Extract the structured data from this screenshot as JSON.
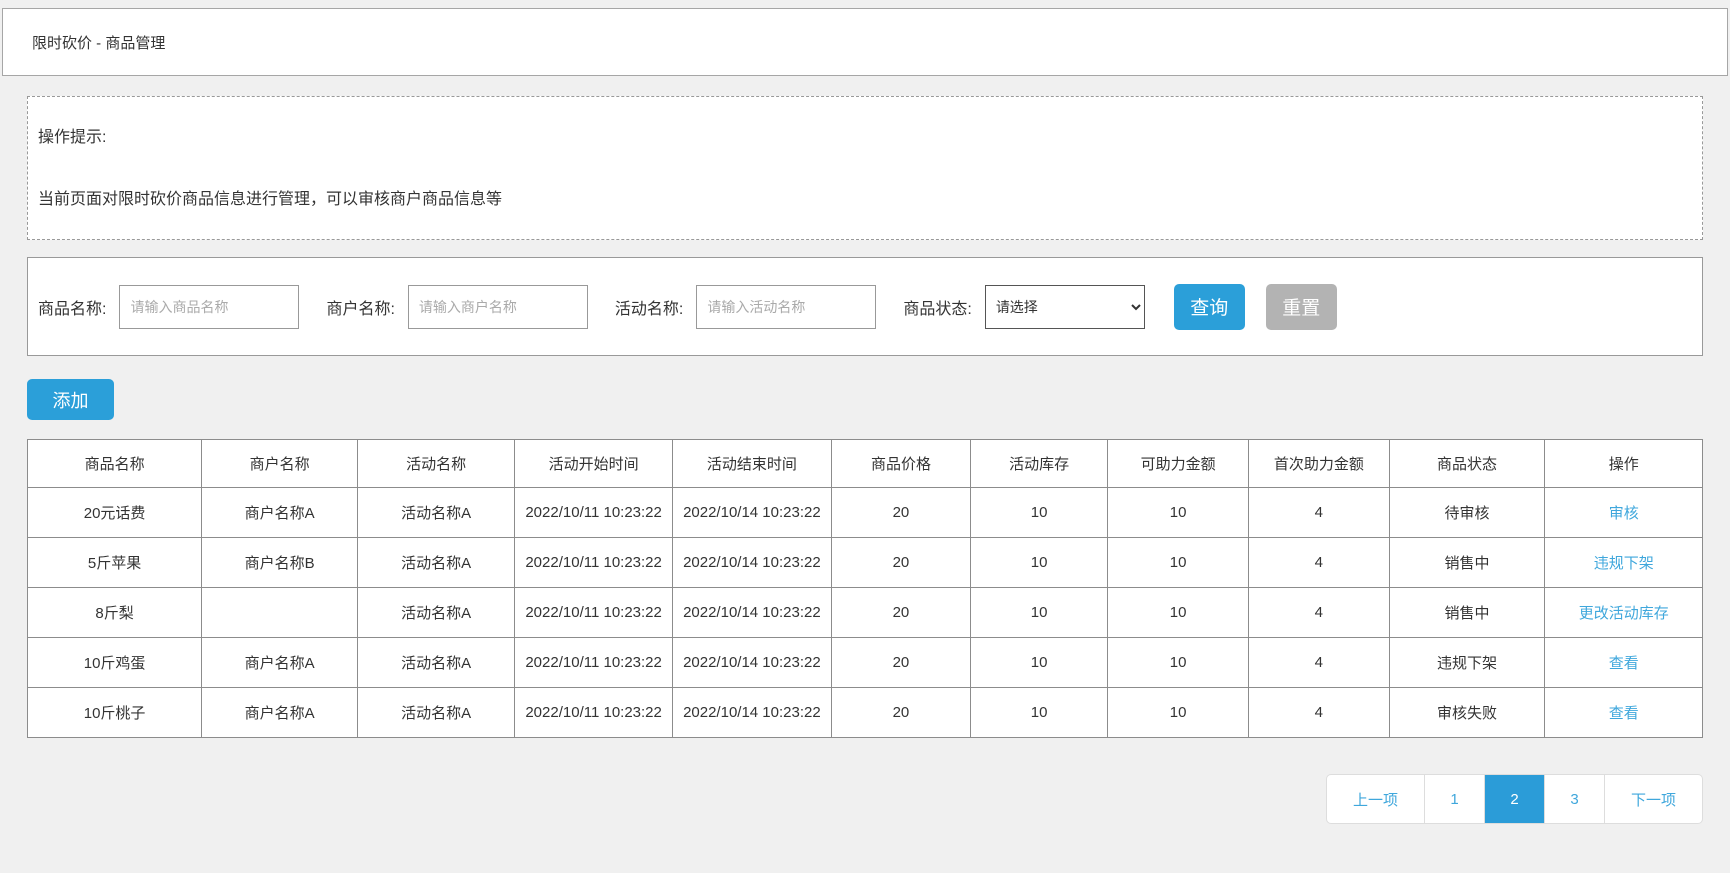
{
  "page": {
    "title": "限时砍价 - 商品管理"
  },
  "tips": {
    "title": "操作提示:",
    "body": "当前页面对限时砍价商品信息进行管理，可以审核商户商品信息等"
  },
  "filters": {
    "fields": [
      {
        "label": "商品名称:",
        "placeholder": "请输入商品名称"
      },
      {
        "label": "商户名称:",
        "placeholder": "请输入商户名称"
      },
      {
        "label": "活动名称:",
        "placeholder": "请输入活动名称"
      }
    ],
    "status": {
      "label": "商品状态:",
      "selected": "请选择"
    },
    "search_label": "查询",
    "reset_label": "重置"
  },
  "toolbar": {
    "add_label": "添加"
  },
  "table": {
    "headers": [
      "商品名称",
      "商户名称",
      "活动名称",
      "活动开始时间",
      "活动结束时间",
      "商品价格",
      "活动库存",
      "可助力金额",
      "首次助力金额",
      "商品状态",
      "操作"
    ],
    "rows": [
      {
        "cells": [
          "20元话费",
          "商户名称A",
          "活动名称A",
          "2022/10/11 10:23:22",
          "2022/10/14 10:23:22",
          "20",
          "10",
          "10",
          "4",
          "待审核"
        ],
        "action": "审核"
      },
      {
        "cells": [
          "5斤苹果",
          "商户名称B",
          "活动名称A",
          "2022/10/11 10:23:22",
          "2022/10/14 10:23:22",
          "20",
          "10",
          "10",
          "4",
          "销售中"
        ],
        "action": "违规下架"
      },
      {
        "cells": [
          "8斤梨",
          "",
          "活动名称A",
          "2022/10/11 10:23:22",
          "2022/10/14 10:23:22",
          "20",
          "10",
          "10",
          "4",
          "销售中"
        ],
        "action": "更改活动库存"
      },
      {
        "cells": [
          "10斤鸡蛋",
          "商户名称A",
          "活动名称A",
          "2022/10/11 10:23:22",
          "2022/10/14 10:23:22",
          "20",
          "10",
          "10",
          "4",
          "违规下架"
        ],
        "action": "查看"
      },
      {
        "cells": [
          "10斤桃子",
          "商户名称A",
          "活动名称A",
          "2022/10/11 10:23:22",
          "2022/10/14 10:23:22",
          "20",
          "10",
          "10",
          "4",
          "审核失败"
        ],
        "action": "查看"
      }
    ]
  },
  "pagination": {
    "prev": "上一项",
    "pages": [
      "1",
      "2",
      "3"
    ],
    "active_page": "2",
    "next": "下一项"
  },
  "colors": {
    "primary": "#2b9fd9",
    "link": "#3fa7dc",
    "reset_button": "#b3b3b3",
    "active_page_bg": "#2b9cd8"
  }
}
